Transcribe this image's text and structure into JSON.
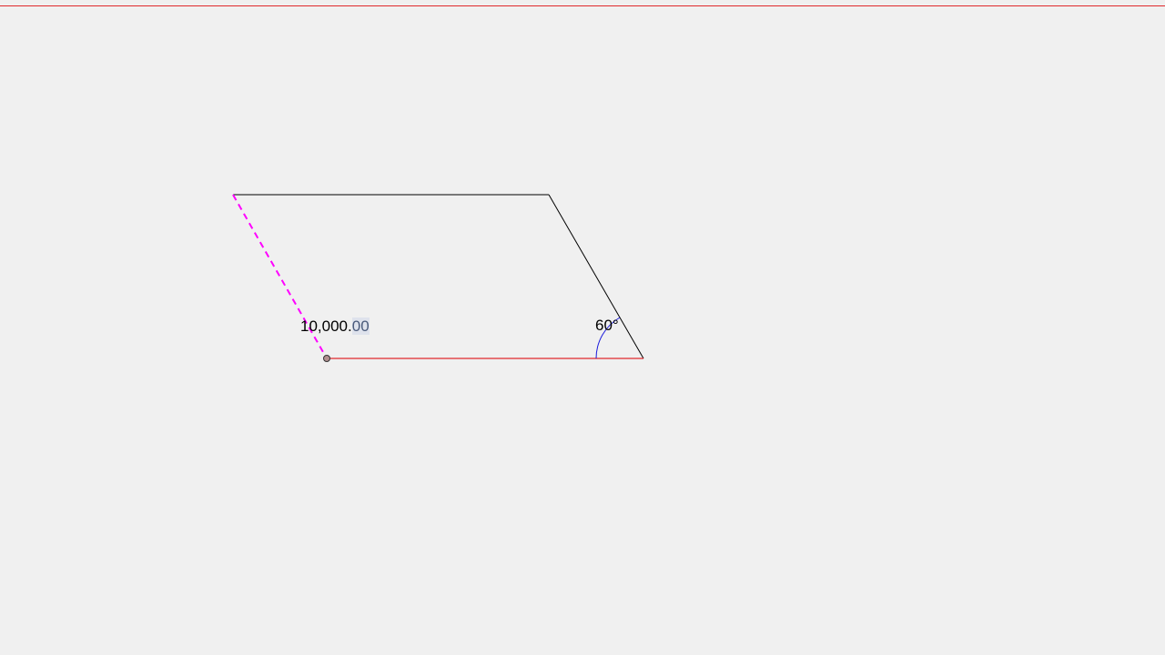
{
  "length_label": {
    "integer_part": "10,000.",
    "decimal_part": "00"
  },
  "angle_label": {
    "value": "60",
    "unit": "°"
  },
  "colors": {
    "background": "#f0f0f0",
    "top_guide": "#e0282c",
    "base_edge": "#e0282c",
    "dashed_edge": "#ff00ff",
    "outline": "#000000",
    "angle_arc": "#1a1adc",
    "anchor_fill": "#b09090"
  }
}
